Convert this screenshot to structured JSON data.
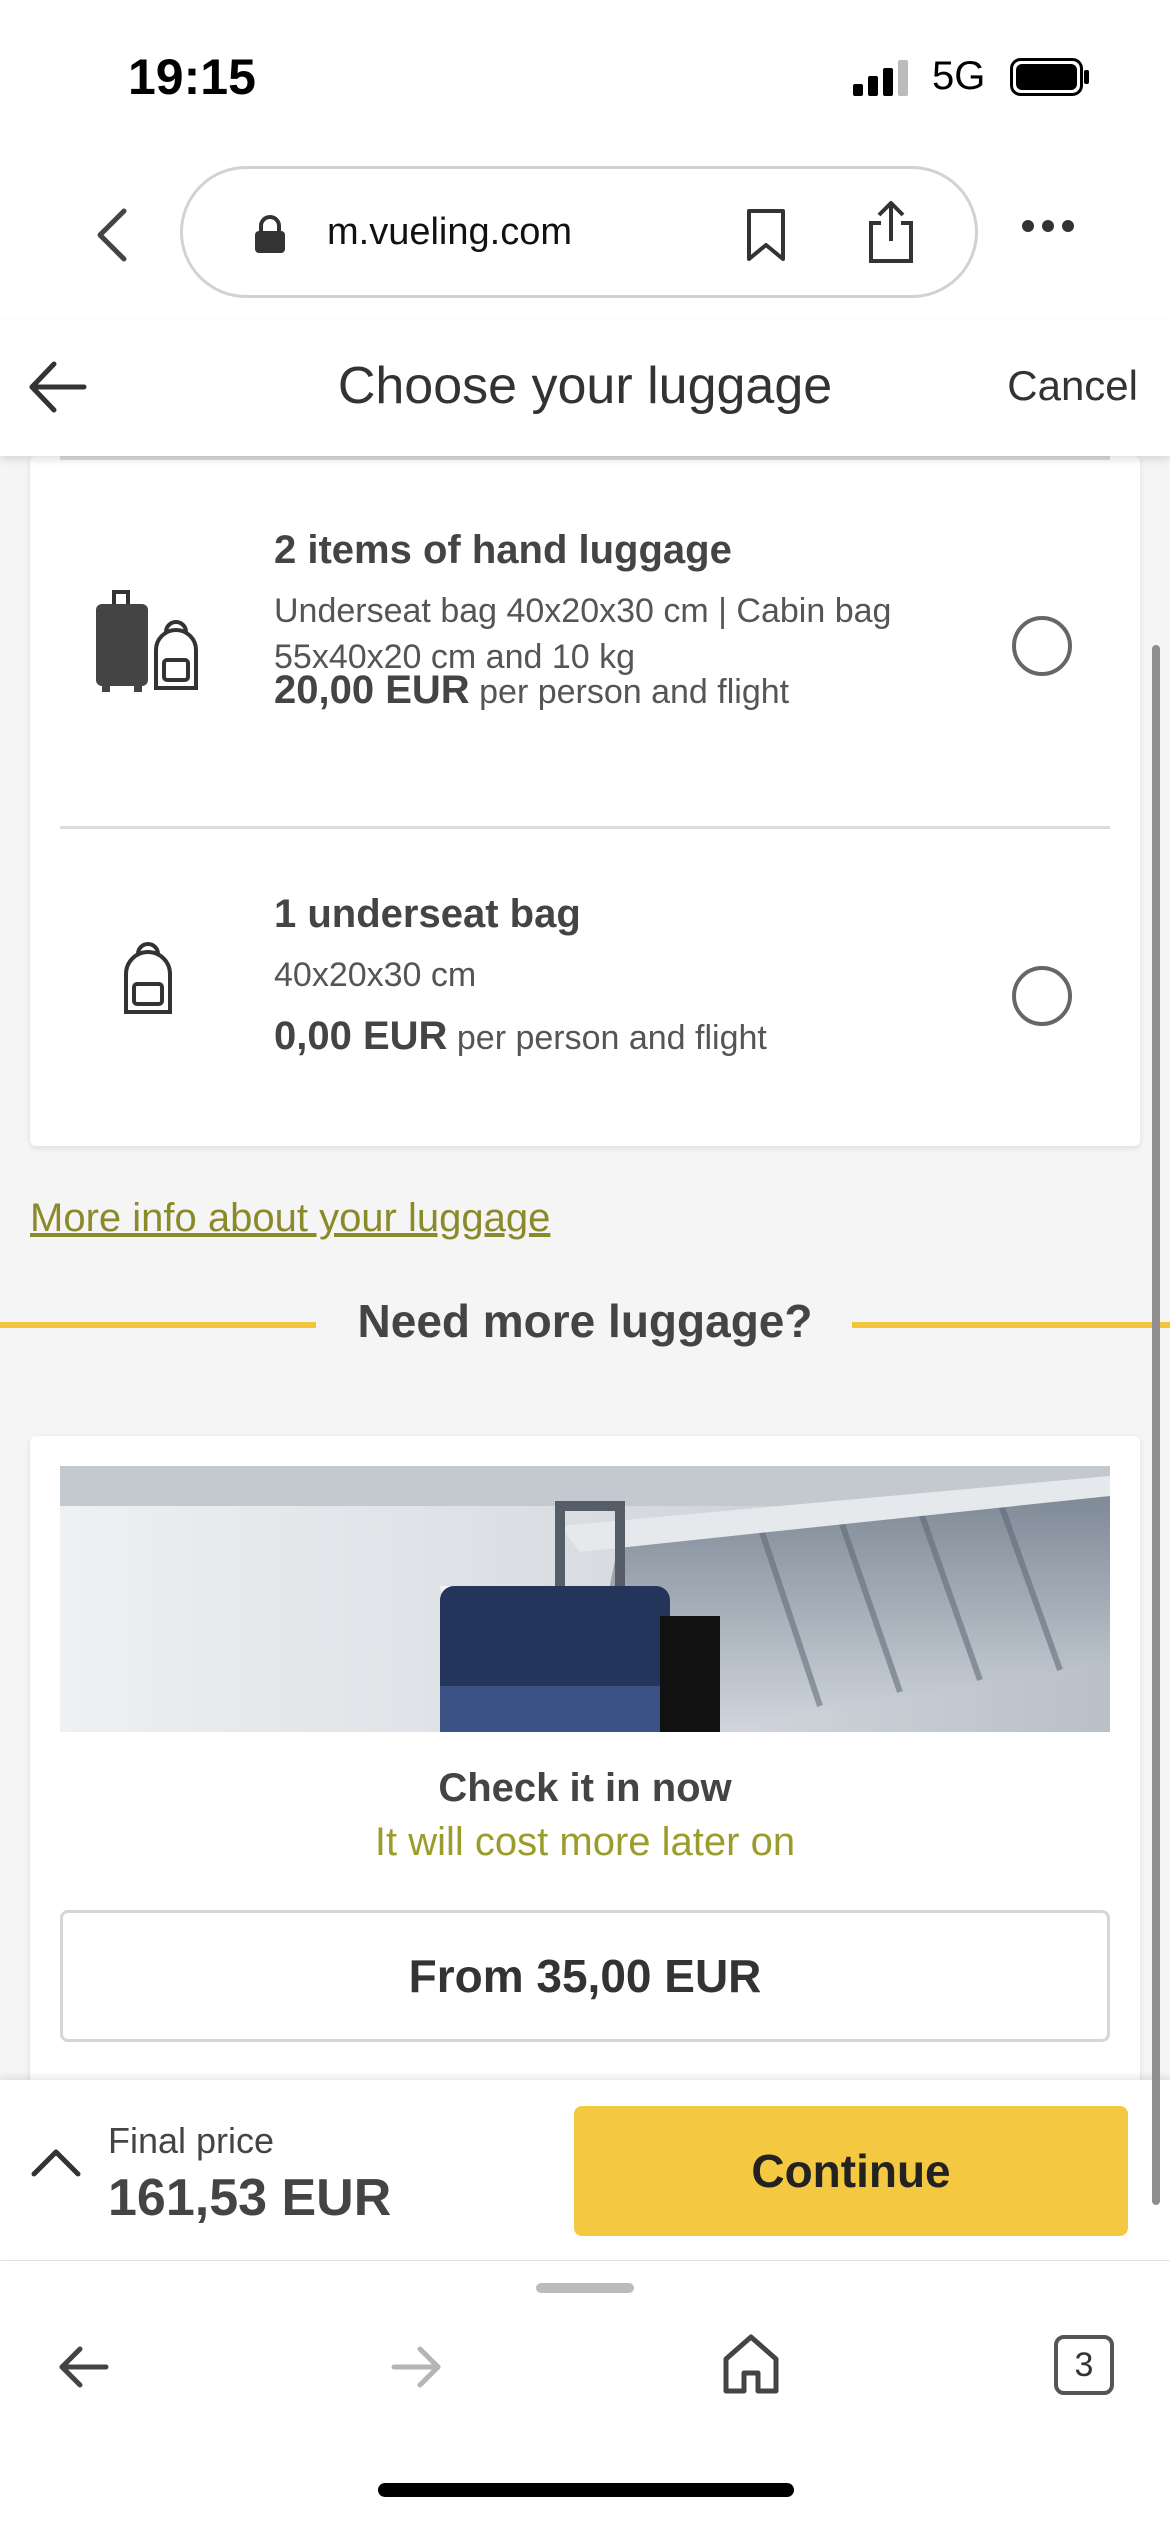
{
  "status_bar": {
    "time": "19:15",
    "network": "5G"
  },
  "browser": {
    "url": "m.vueling.com"
  },
  "header": {
    "title": "Choose your luggage",
    "cancel": "Cancel"
  },
  "options": [
    {
      "title": "2 items of hand luggage",
      "desc": "Underseat bag 40x20x30 cm | Cabin bag 55x40x20 cm and 10 kg",
      "price": "20,00 EUR",
      "price_suffix": "per person and flight",
      "icon": "suitcase-and-backpack-icon",
      "selected": false
    },
    {
      "title": "1 underseat bag",
      "desc": "40x20x30 cm",
      "price": "0,00 EUR",
      "price_suffix": "per person and flight",
      "icon": "backpack-icon",
      "selected": false
    }
  ],
  "more_info_link": "More info about your luggage",
  "need_more": {
    "title": "Need more luggage?"
  },
  "checkin": {
    "title": "Check it in now",
    "subtitle": "It will cost more later on",
    "button": "From 35,00 EUR"
  },
  "footer": {
    "label": "Final price",
    "value": "161,53 EUR",
    "continue": "Continue"
  },
  "toolbar": {
    "tab_count": "3"
  },
  "colors": {
    "accent_yellow": "#f5c842",
    "link_olive": "#8a8a2a"
  }
}
